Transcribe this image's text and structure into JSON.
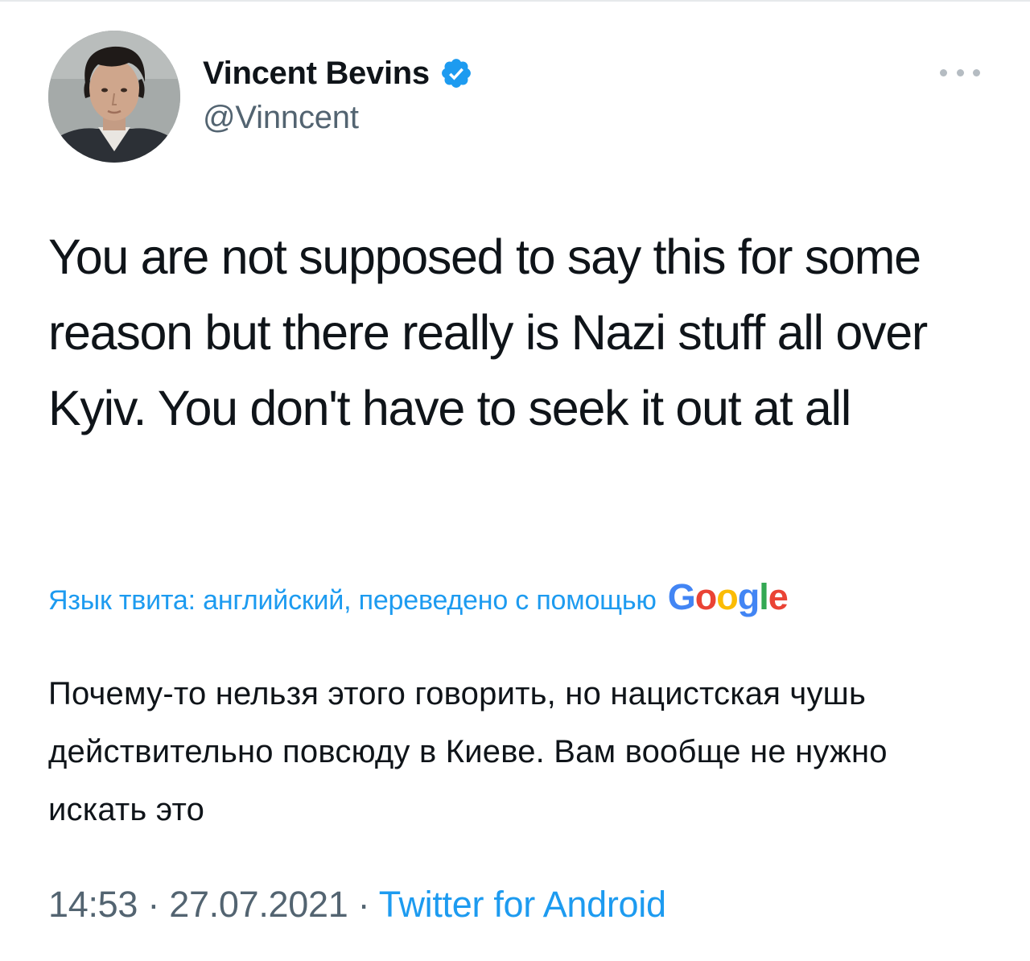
{
  "tweet": {
    "author": {
      "display_name": "Vincent Bevins",
      "handle": "@Vinncent",
      "verified": true
    },
    "text": "You are not supposed to say this for some reason but there really is Nazi stuff all over Kyiv. You don't have to seek it out at all",
    "translation": {
      "label": "Язык твита: английский, переведено с помощью",
      "provider_logo_text": "Google",
      "text": "Почему-то нельзя этого говорить, но нацистская чушь действительно повсюду в Киеве. Вам вообще не нужно искать это"
    },
    "time": "14:53",
    "separator": "·",
    "date": "27.07.2021",
    "source": "Twitter for Android"
  },
  "colors": {
    "accent": "#1d9bf0",
    "text": "#0f1419",
    "muted": "#536471"
  },
  "icons": {
    "verified": "verified-badge-icon",
    "more": "more-options-icon",
    "avatar": "profile-photo"
  }
}
